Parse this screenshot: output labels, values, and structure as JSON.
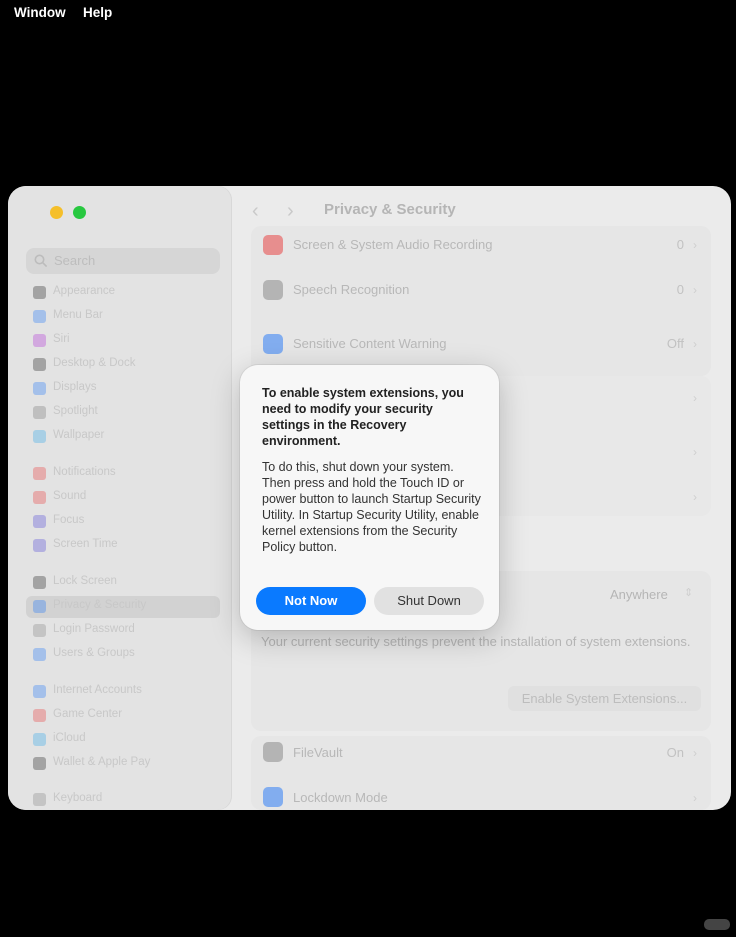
{
  "menubar": {
    "window": "Window",
    "help": "Help"
  },
  "colors": {
    "traffic_yellow": "#f5bf2a",
    "traffic_green": "#28c840",
    "accent": "#0a7aff"
  },
  "window": {
    "title": "Privacy & Security",
    "nav_back_icon": "chevron-left-icon",
    "nav_forward_icon": "chevron-right-icon"
  },
  "sidebar": {
    "search_placeholder": "Search",
    "items": [
      {
        "label": "Appearance",
        "icon": "appearance-icon",
        "color": "#2b2b2b"
      },
      {
        "label": "Menu Bar",
        "icon": "menubar-icon",
        "color": "#2f7df6"
      },
      {
        "label": "Siri",
        "icon": "siri-icon",
        "color": "#b33ad6"
      },
      {
        "label": "Desktop & Dock",
        "icon": "dock-icon",
        "color": "#2b2b2b"
      },
      {
        "label": "Displays",
        "icon": "displays-icon",
        "color": "#2f7df6"
      },
      {
        "label": "Spotlight",
        "icon": "spotlight-icon",
        "color": "#7a7a7a"
      },
      {
        "label": "Wallpaper",
        "icon": "wallpaper-icon",
        "color": "#3aa8e8"
      },
      {
        "label": "Notifications",
        "icon": "notifications-icon",
        "color": "#e84545"
      },
      {
        "label": "Sound",
        "icon": "sound-icon",
        "color": "#e84545"
      },
      {
        "label": "Focus",
        "icon": "focus-icon",
        "color": "#5a4fd6"
      },
      {
        "label": "Screen Time",
        "icon": "screentime-icon",
        "color": "#5a4fd6"
      },
      {
        "label": "Lock Screen",
        "icon": "lock-icon",
        "color": "#2b2b2b"
      },
      {
        "label": "Privacy & Security",
        "icon": "hand-icon",
        "color": "#2f7df6"
      },
      {
        "label": "Login Password",
        "icon": "key-icon",
        "color": "#8a8a8a"
      },
      {
        "label": "Users & Groups",
        "icon": "users-icon",
        "color": "#2f7df6"
      },
      {
        "label": "Internet Accounts",
        "icon": "at-icon",
        "color": "#2f7df6"
      },
      {
        "label": "Game Center",
        "icon": "gamecenter-icon",
        "color": "#e84545"
      },
      {
        "label": "iCloud",
        "icon": "cloud-icon",
        "color": "#3aa8e8"
      },
      {
        "label": "Wallet & Apple Pay",
        "icon": "wallet-icon",
        "color": "#2b2b2b"
      },
      {
        "label": "Keyboard",
        "icon": "keyboard-icon",
        "color": "#8a8a8a"
      }
    ]
  },
  "settings": {
    "screen_recording": {
      "label": "Screen & System Audio Recording",
      "value": "0",
      "icon": "record-icon",
      "color": "#e84545"
    },
    "speech": {
      "label": "Speech Recognition",
      "value": "0",
      "icon": "waveform-icon",
      "color": "#8a8a8a"
    },
    "sensitive": {
      "label": "Sensitive Content Warning",
      "value": "Off",
      "icon": "eye-icon",
      "color": "#2f7df6"
    },
    "allow_from": "Anywhere",
    "extensions_text": "Your current security settings prevent the installation of system extensions.",
    "enable_ext_button": "Enable System Extensions...",
    "filevault": {
      "label": "FileVault",
      "value": "On",
      "icon": "filevault-icon",
      "color": "#8a8a8a"
    },
    "lockdown": {
      "label": "Lockdown Mode",
      "icon": "hand-raised-icon",
      "color": "#2f7df6"
    }
  },
  "dialog": {
    "title": "To enable system extensions, you need to modify your security settings in the Recovery environment.",
    "body": "To do this, shut down your system. Then press and hold the Touch ID or power button to launch Startup Security Utility. In Startup Security Utility, enable kernel extensions from the Security Policy button.",
    "primary_button": "Not Now",
    "secondary_button": "Shut Down"
  },
  "badge": "小红书"
}
